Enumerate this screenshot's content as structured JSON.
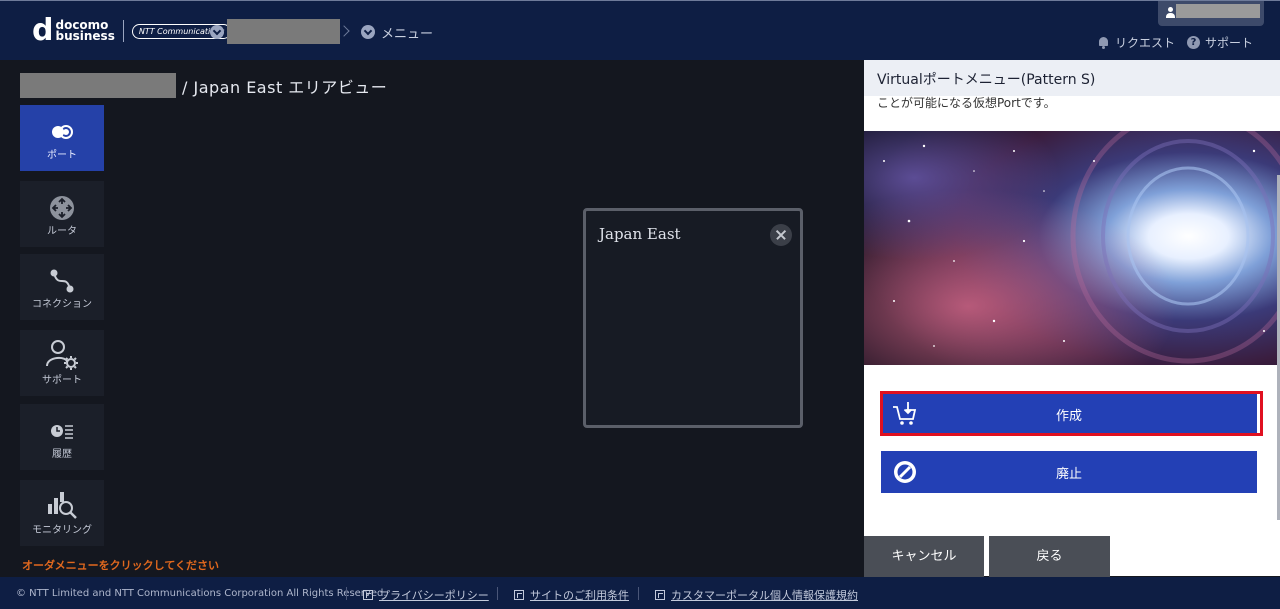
{
  "header": {
    "logo_line1": "docomo",
    "logo_line2": "business",
    "logo_ntt": "NTT Communications",
    "crumb_menu": "メニュー",
    "request_label": "リクエスト",
    "support_label": "サポート"
  },
  "page": {
    "title": "/ Japan East エリアビュー"
  },
  "sidebar": {
    "items": [
      {
        "label": "ポート",
        "icon": "port-icon",
        "active": true
      },
      {
        "label": "ルータ",
        "icon": "router-icon",
        "active": false
      },
      {
        "label": "コネクション",
        "icon": "connection-icon",
        "active": false
      },
      {
        "label": "サポート",
        "icon": "support-user-gear-icon",
        "active": false
      },
      {
        "label": "履歴",
        "icon": "history-icon",
        "active": false
      },
      {
        "label": "モニタリング",
        "icon": "monitoring-icon",
        "active": false
      }
    ]
  },
  "order_message": "オーダメニューをクリックしてください",
  "region_card": {
    "title": "Japan East"
  },
  "panel": {
    "title": "Virtualポートメニュー(Pattern S)",
    "description": "ことが可能になる仮想Portです。",
    "create_label": "作成",
    "abolish_label": "廃止",
    "cancel_label": "キャンセル",
    "back_label": "戻る"
  },
  "footer": {
    "copyright": "© NTT Limited and NTT Communications Corporation All Rights Reserved.",
    "privacy": "プライバシーポリシー",
    "terms": "サイトのご利用条件",
    "customer_privacy": "カスタマーポータル個人情報保護規約"
  },
  "colors": {
    "header_bg": "#0e1e44",
    "accent_blue": "#2340b5",
    "highlight_red": "#e01020",
    "order_orange": "#e0681e"
  }
}
